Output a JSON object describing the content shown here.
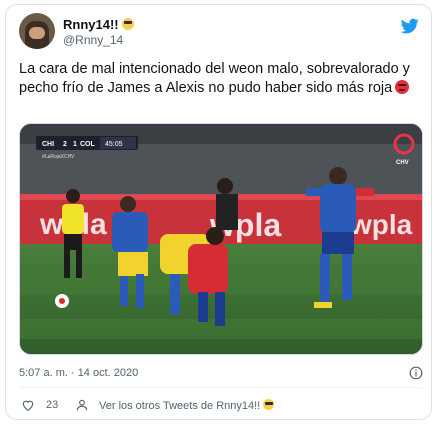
{
  "author": {
    "display_name": "Rnny14!!",
    "handle": "@Rnny_14"
  },
  "tweet": {
    "text": "La cara de mal intencionado del weon malo, sobrevalorado y pecho frío de James a Alexis no pudo haber sido más roja"
  },
  "media": {
    "scoreboard": {
      "home": "CHI",
      "home_score": "2",
      "away_score": "1",
      "away": "COL",
      "clock": "45:05"
    },
    "hashtag": "#LaRojaXCHV",
    "ad_board_text": "wpla",
    "ad_board_text_2": "wpla",
    "ad_board_text_3": "wpla",
    "broadcaster": "CHV"
  },
  "meta": {
    "timestamp": "5:07 a. m. · 14 oct. 2020"
  },
  "actions": {
    "like_count": "23",
    "see_more_label": "Ver los otros Tweets de Rnny14!!"
  },
  "colors": {
    "twitter_blue": "#1d9bf0",
    "muted_text": "#536471",
    "grass": "#3f7a3a",
    "chile_red": "#d62d34",
    "colombia_yellow": "#f2d22c"
  },
  "icons": [
    "twitter-bird-icon",
    "info-icon",
    "heart-icon",
    "person-icon",
    "sunglasses-emoji-icon",
    "angry-emoji-icon"
  ]
}
